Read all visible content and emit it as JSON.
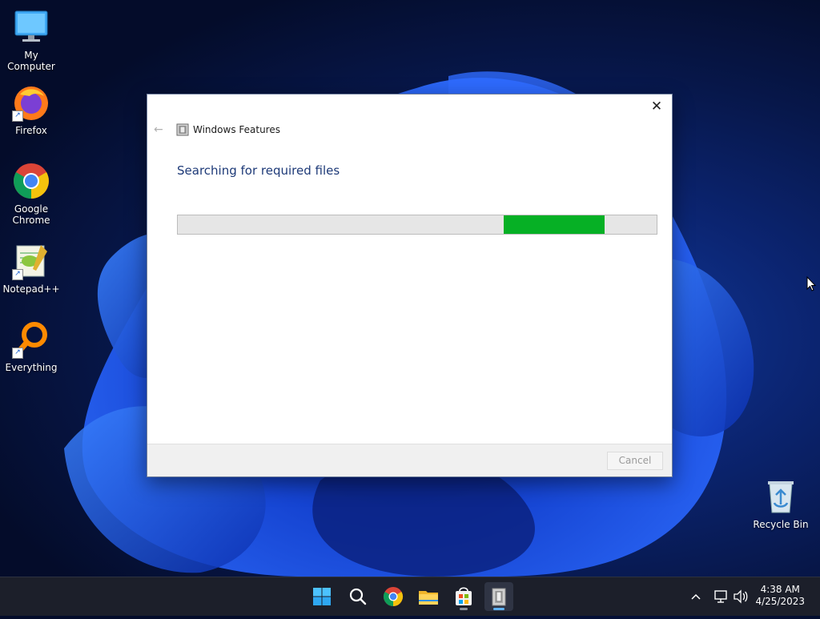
{
  "desktop": {
    "icons": [
      {
        "label": "My Computer",
        "icon": "computer-icon"
      },
      {
        "label": "Firefox",
        "icon": "firefox-icon"
      },
      {
        "label": "Google Chrome",
        "icon": "chrome-icon"
      },
      {
        "label": "Notepad++",
        "icon": "notepadpp-icon"
      },
      {
        "label": "Everything",
        "icon": "everything-icon"
      },
      {
        "label": "Recycle Bin",
        "icon": "recycle-bin-icon"
      }
    ]
  },
  "dialog": {
    "title": "Windows Features",
    "heading": "Searching for required files",
    "progress": {
      "fill_start": 0.68,
      "fill_end": 0.89,
      "color": "#06b025"
    },
    "cancel_label": "Cancel",
    "close_glyph": "✕",
    "back_glyph": "←"
  },
  "taskbar": {
    "apps": [
      "start-icon",
      "search-icon",
      "chrome-icon",
      "file-explorer-icon",
      "microsoft-store-icon",
      "windows-features-icon"
    ],
    "clock": {
      "time": "4:38 AM",
      "date": "4/25/2023"
    }
  },
  "colors": {
    "accent": "#5fb2f2",
    "heading": "#1e3a78"
  }
}
